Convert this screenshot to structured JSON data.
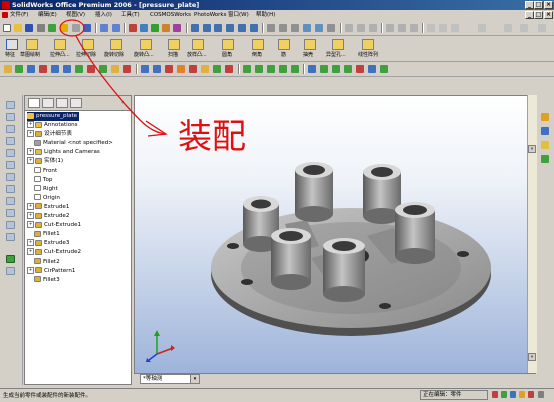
{
  "titlebar": {
    "title": "SolidWorks Office Premium 2006 - [pressure_plate]",
    "min": "_",
    "max": "□",
    "close": "×"
  },
  "menubar": {
    "items": [
      "文件(F)",
      "编辑(E)",
      "视图(V)",
      "插入(I)",
      "工具(T)",
      "COSMOSWorks",
      "PhotoWorks",
      "窗口(W)",
      "帮助(H)"
    ]
  },
  "features_toolbar": {
    "items": [
      "特征",
      "草图绘制",
      "拉伸凸...",
      "拉伸切除",
      "旋转切除",
      "旋转凸...",
      "扫描",
      "放样凸...",
      "圆角",
      "倒角",
      "筋",
      "抽壳",
      "异型孔...",
      "线性阵列"
    ]
  },
  "feature_tree": {
    "root": "pressure_plate",
    "items": [
      {
        "label": "Annotations",
        "exp": "+"
      },
      {
        "label": "设计细节表",
        "exp": "+"
      },
      {
        "label": "Material <not specified>",
        "exp": ""
      },
      {
        "label": "Lights and Cameras",
        "exp": "+"
      },
      {
        "label": "实体(1)",
        "exp": "+"
      },
      {
        "label": "Front",
        "exp": ""
      },
      {
        "label": "Top",
        "exp": ""
      },
      {
        "label": "Right",
        "exp": ""
      },
      {
        "label": "Origin",
        "exp": ""
      },
      {
        "label": "Extrude1",
        "exp": "+"
      },
      {
        "label": "Extrude2",
        "exp": "+"
      },
      {
        "label": "Cut-Extrude1",
        "exp": "+"
      },
      {
        "label": "Fillet1",
        "exp": ""
      },
      {
        "label": "Extrude3",
        "exp": "+"
      },
      {
        "label": "Cut-Extrude2",
        "exp": "+"
      },
      {
        "label": "Fillet2",
        "exp": ""
      },
      {
        "label": "CirPattern1",
        "exp": "+"
      },
      {
        "label": "Fillet3",
        "exp": ""
      }
    ]
  },
  "annotation": {
    "handwriting": "装配"
  },
  "view_selector": {
    "value": "*等轴测"
  },
  "status": {
    "message": "生成当前零件或装配件的新装配件。",
    "mode": "正在编辑：零件"
  },
  "colors": {
    "title_start": "#0a246a",
    "title_end": "#3a6ea5",
    "annotation_red": "#e01010",
    "selection": "#0a246a"
  }
}
